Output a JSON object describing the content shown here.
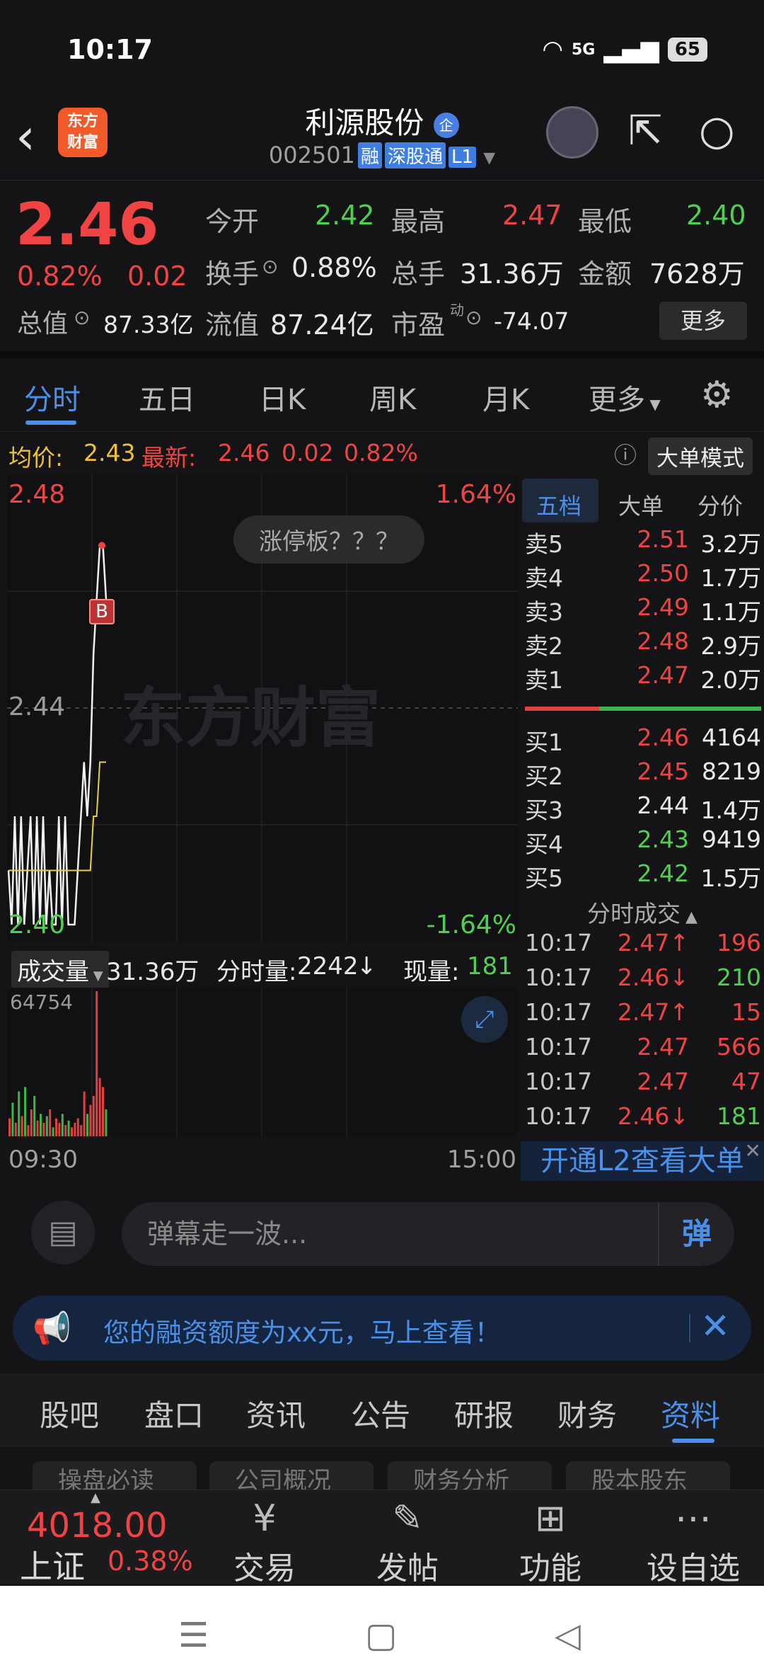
{
  "status": {
    "time": "10:17",
    "network": "5G",
    "battery": "65"
  },
  "header": {
    "logo_line1": "东方",
    "logo_line2": "财富",
    "stock_name": "利源股份",
    "enterprise_badge": "企",
    "stock_code": "002501",
    "tags": [
      "融",
      "深股通",
      "L1"
    ]
  },
  "quote": {
    "price": "2.46",
    "change_pct": "0.82%",
    "change": "0.02",
    "fields": [
      {
        "label": "今开",
        "value": "2.42",
        "color": "green"
      },
      {
        "label": "最高",
        "value": "2.47",
        "color": "red"
      },
      {
        "label": "最低",
        "value": "2.40",
        "color": "green"
      },
      {
        "label": "换手",
        "value": "0.88%",
        "color": "white"
      },
      {
        "label": "总手",
        "value": "31.36万",
        "color": "white"
      },
      {
        "label": "金额",
        "value": "7628万",
        "color": "white"
      },
      {
        "label": "总值",
        "value": "87.33亿",
        "color": "white"
      },
      {
        "label": "流值",
        "value": "87.24亿",
        "color": "white"
      },
      {
        "label": "市盈",
        "value": "-74.07",
        "color": "white"
      }
    ],
    "pe_superscript": "动",
    "more_button": "更多"
  },
  "tabs": [
    "分时",
    "五日",
    "日K",
    "周K",
    "月K",
    "更多"
  ],
  "avg_line": {
    "avg_label": "均价:",
    "avg_value": "2.43",
    "latest_label": "最新:",
    "latest_price": "2.46",
    "latest_change": "0.02",
    "latest_pct": "0.82%",
    "big_order_mode": "大单模式"
  },
  "chart": {
    "y_top": "2.48",
    "y_mid": "2.44",
    "y_bottom": "2.40",
    "pct_top": "1.64%",
    "pct_bottom": "-1.64%",
    "limit_bubble": "涨停板？？？",
    "watermark": "东方财富",
    "marker": "B",
    "volume_selector": "成交量",
    "total_volume": "31.36万",
    "tick_volume_label": "分时量:",
    "tick_volume": "2242",
    "current_volume_label": "现量:",
    "current_volume": "181",
    "volume_max": "64754",
    "time_start": "09:30",
    "time_end": "15:00"
  },
  "chart_data": {
    "type": "line",
    "title": "",
    "ylim": [
      2.4,
      2.48
    ],
    "series": [
      {
        "name": "",
        "values": [
          2.41,
          2.4,
          2.42,
          2.4,
          2.42,
          2.4,
          2.41,
          2.42,
          2.4,
          2.42,
          2.4,
          2.42,
          2.4,
          2.41,
          2.4,
          2.4,
          2.42,
          2.4,
          2.42,
          2.4,
          2.4,
          2.4,
          2.41,
          2.42,
          2.43,
          2.42,
          2.43,
          2.45,
          2.46,
          2.47,
          2.47,
          2.46
        ]
      },
      {
        "name": "均价",
        "values": [
          2.41,
          2.41,
          2.41,
          2.41,
          2.41,
          2.41,
          2.41,
          2.41,
          2.41,
          2.41,
          2.41,
          2.41,
          2.41,
          2.41,
          2.41,
          2.41,
          2.41,
          2.41,
          2.41,
          2.41,
          2.41,
          2.41,
          2.41,
          2.41,
          2.41,
          2.41,
          2.41,
          2.42,
          2.42,
          2.43,
          2.43,
          2.43
        ]
      }
    ],
    "volume": [
      8000,
      15000,
      6000,
      20000,
      9000,
      22000,
      5000,
      12000,
      18000,
      7000,
      10000,
      6000,
      9000,
      12000,
      4000,
      8000,
      6000,
      10000,
      5000,
      7000,
      4000,
      6000,
      8000,
      5000,
      20000,
      10000,
      14000,
      18000,
      64754,
      26000,
      22000,
      12000
    ]
  },
  "order_book": {
    "tabs": [
      "五档",
      "大单",
      "分价"
    ],
    "asks": [
      {
        "label": "卖5",
        "price": "2.51",
        "volume": "3.2万",
        "color": "red"
      },
      {
        "label": "卖4",
        "price": "2.50",
        "volume": "1.7万",
        "color": "red"
      },
      {
        "label": "卖3",
        "price": "2.49",
        "volume": "1.1万",
        "color": "red"
      },
      {
        "label": "卖2",
        "price": "2.48",
        "volume": "2.9万",
        "color": "red"
      },
      {
        "label": "卖1",
        "price": "2.47",
        "volume": "2.0万",
        "color": "red"
      }
    ],
    "bids": [
      {
        "label": "买1",
        "price": "2.46",
        "volume": "4164",
        "color": "red"
      },
      {
        "label": "买2",
        "price": "2.45",
        "volume": "8219",
        "color": "red"
      },
      {
        "label": "买3",
        "price": "2.44",
        "volume": "1.4万",
        "color": "white"
      },
      {
        "label": "买4",
        "price": "2.43",
        "volume": "9419",
        "color": "green"
      },
      {
        "label": "买5",
        "price": "2.42",
        "volume": "1.5万",
        "color": "green"
      }
    ],
    "trades_title": "分时成交",
    "trades": [
      {
        "time": "10:17",
        "price": "2.47↑",
        "volume": "196",
        "pcolor": "red",
        "vcolor": "red"
      },
      {
        "time": "10:17",
        "price": "2.46↓",
        "volume": "210",
        "pcolor": "red",
        "vcolor": "green"
      },
      {
        "time": "10:17",
        "price": "2.47↑",
        "volume": "15",
        "pcolor": "red",
        "vcolor": "red"
      },
      {
        "time": "10:17",
        "price": "2.47",
        "volume": "566",
        "pcolor": "red",
        "vcolor": "red"
      },
      {
        "time": "10:17",
        "price": "2.47",
        "volume": "47",
        "pcolor": "red",
        "vcolor": "red"
      },
      {
        "time": "10:17",
        "price": "2.46↓",
        "volume": "181",
        "pcolor": "red",
        "vcolor": "green"
      }
    ],
    "l2_banner": "开通L2查看大单"
  },
  "danmu": {
    "placeholder": "弹幕走一波...",
    "button": "弹"
  },
  "margin_banner": {
    "text": "您的融资额度为xx元，马上查看！"
  },
  "subtabs": [
    "股吧",
    "盘口",
    "资讯",
    "公告",
    "研报",
    "财务",
    "资料"
  ],
  "chips": [
    "操盘必读",
    "公司概况",
    "财务分析",
    "股本股东"
  ],
  "bottom_nav": {
    "index_price": "4018.00",
    "index_name": "上证",
    "index_pct": "0.38%",
    "items": [
      {
        "label": "交易",
        "icon": "trade-icon"
      },
      {
        "label": "发帖",
        "icon": "edit-icon"
      },
      {
        "label": "功能",
        "icon": "apps-icon"
      },
      {
        "label": "设自选",
        "icon": "more-icon"
      }
    ]
  }
}
